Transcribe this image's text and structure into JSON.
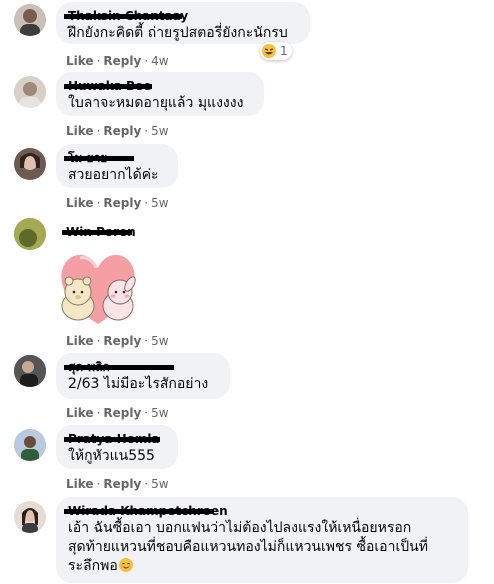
{
  "comments": [
    {
      "name": "Thaksin Chantaay",
      "text": "ฝึกยังกะคิดตี้ ถ่ายรูปสตอรี่ยังกะนักรบ",
      "time": "4w",
      "reaction_count": "1"
    },
    {
      "name": "Huwaka Bee",
      "text": "ใบลาจะหมดอายุแล้ว มุแงงงง",
      "time": "5w"
    },
    {
      "name": "โม ยาย",
      "text": "สวยอยากได้ค่ะ",
      "time": "5w"
    },
    {
      "name": "Win Poren",
      "sticker": "bear-bunny-heart-sticker",
      "time": "5w"
    },
    {
      "name": "สุด พลิก",
      "text": "2/63 ไม่มีอะไรสักอย่าง",
      "time": "5w"
    },
    {
      "name": "Pratya Homla",
      "text": "ให้กูหัวแน555",
      "time": "5w"
    },
    {
      "name": "Wirada Khampetchroen",
      "text_lines": [
        "เอ้า ฉันซื้อเอา บอกแฟนว่าไม่ต้องไปลงแรงให้เหนื่อยหรอก",
        "สุดท้ายแหวนที่ชอบคือแหวนทองไม่ก็แหวนเพชร ซื้อเอาเป็นที่",
        "ระลึกพอ"
      ],
      "emoji": "smiling-face-icon",
      "time": "5w"
    }
  ],
  "actions": {
    "like": "Like",
    "reply": "Reply",
    "separator": "·"
  }
}
